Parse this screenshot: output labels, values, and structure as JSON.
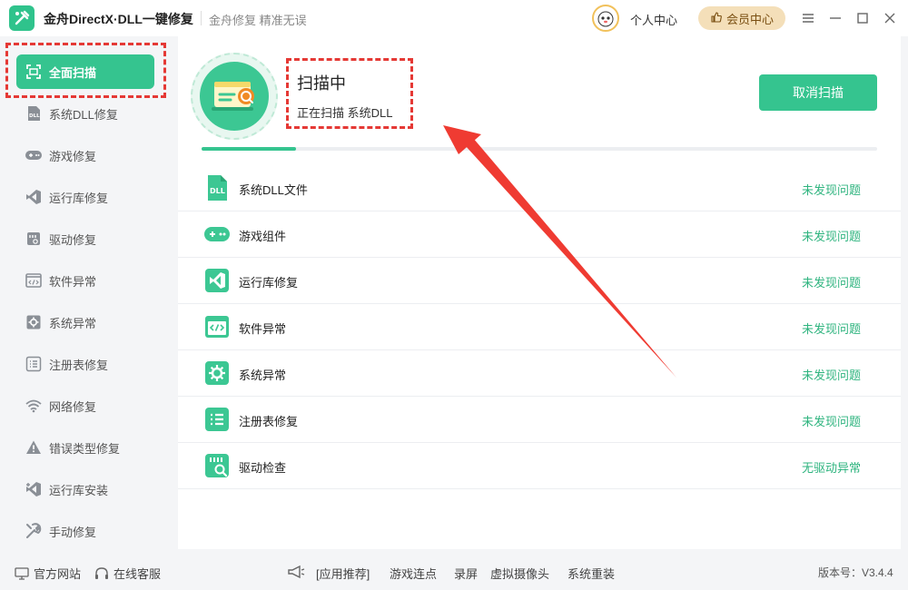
{
  "app": {
    "title": "金舟DirectX·DLL一键修复",
    "slogan": "金舟修复 精准无误"
  },
  "header": {
    "user_center": "个人中心",
    "vip_center": "会员中心",
    "window_controls": [
      "menu-icon",
      "minimize-icon",
      "maximize-icon",
      "close-icon"
    ]
  },
  "sidebar": {
    "items": [
      {
        "label": "全面扫描",
        "icon": "scan-icon",
        "active": true
      },
      {
        "label": "系统DLL修复",
        "icon": "dll-icon"
      },
      {
        "label": "游戏修复",
        "icon": "gamepad-icon"
      },
      {
        "label": "运行库修复",
        "icon": "visual-studio-icon"
      },
      {
        "label": "驱动修复",
        "icon": "driver-icon"
      },
      {
        "label": "软件异常",
        "icon": "code-window-icon"
      },
      {
        "label": "系统异常",
        "icon": "gear-icon"
      },
      {
        "label": "注册表修复",
        "icon": "list-icon"
      },
      {
        "label": "网络修复",
        "icon": "wifi-icon"
      },
      {
        "label": "错误类型修复",
        "icon": "warning-icon"
      },
      {
        "label": "运行库安装",
        "icon": "install-icon"
      },
      {
        "label": "手动修复",
        "icon": "wrench-icon"
      }
    ]
  },
  "scan": {
    "title": "扫描中",
    "subtitle": "正在扫描 系统DLL",
    "cancel_label": "取消扫描",
    "progress": 0.14
  },
  "results": [
    {
      "name": "系统DLL文件",
      "status": "未发现问题",
      "icon": "dll-file-icon"
    },
    {
      "name": "游戏组件",
      "status": "未发现问题",
      "icon": "gamepad-icon"
    },
    {
      "name": "运行库修复",
      "status": "未发现问题",
      "icon": "visual-studio-icon"
    },
    {
      "name": "软件异常",
      "status": "未发现问题",
      "icon": "code-window-icon"
    },
    {
      "name": "系统异常",
      "status": "未发现问题",
      "icon": "gear-icon"
    },
    {
      "name": "注册表修复",
      "status": "未发现问题",
      "icon": "list-icon"
    },
    {
      "name": "驱动检查",
      "status": "无驱动异常",
      "icon": "driver-icon"
    }
  ],
  "footer": {
    "official_site": "官方网站",
    "online_service": "在线客服",
    "recommend_label": "[应用推荐]",
    "links": [
      "游戏连点",
      "录屏",
      "虚拟摄像头",
      "系统重装"
    ],
    "version": "版本号：V3.4.4"
  },
  "colors": {
    "accent": "#35c48f",
    "status_ok": "#2fb47f",
    "highlight": "#e53935",
    "vip_bg": "#f4dfb9"
  }
}
